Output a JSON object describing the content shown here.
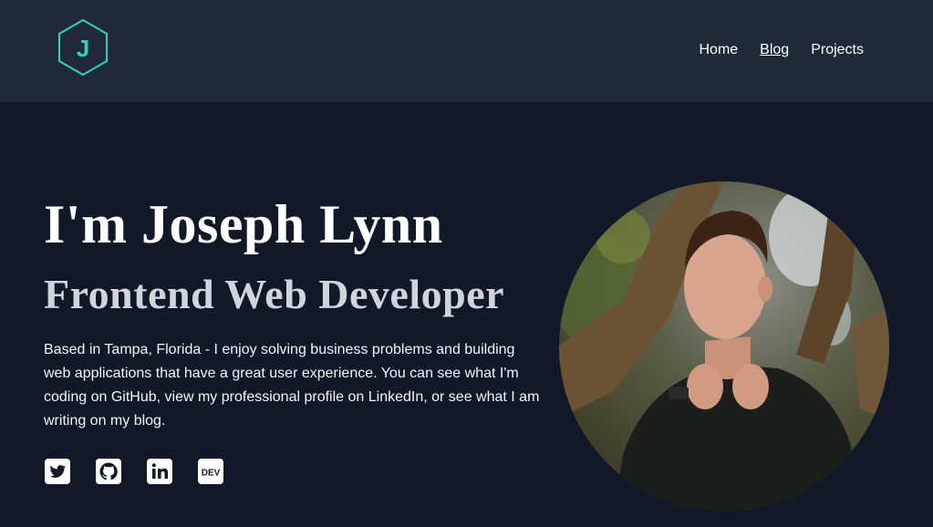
{
  "logo": {
    "letter": "J",
    "icon": "hexagon-logo-icon",
    "color": "#2dd4bf"
  },
  "nav": {
    "items": [
      {
        "label": "Home",
        "active": false
      },
      {
        "label": "Blog",
        "active": true
      },
      {
        "label": "Projects",
        "active": false
      }
    ]
  },
  "hero": {
    "title": "I'm Joseph Lynn",
    "subtitle": "Frontend Web Developer",
    "description": "Based in Tampa, Florida - I enjoy solving business problems and building web applications that have a great user experience. You can see what I'm coding on GitHub, view my professional profile on LinkedIn, or see what I am writing on my blog."
  },
  "social": [
    {
      "icon": "twitter-icon"
    },
    {
      "icon": "github-icon"
    },
    {
      "icon": "linkedin-icon"
    },
    {
      "icon": "dev-icon",
      "text": "DEV"
    }
  ],
  "photo": {
    "subject": "portrait-photo"
  },
  "colors": {
    "background": "#111827",
    "header": "#1f2937",
    "accent": "#2dd4bf",
    "subtitle": "#d1d5db"
  }
}
